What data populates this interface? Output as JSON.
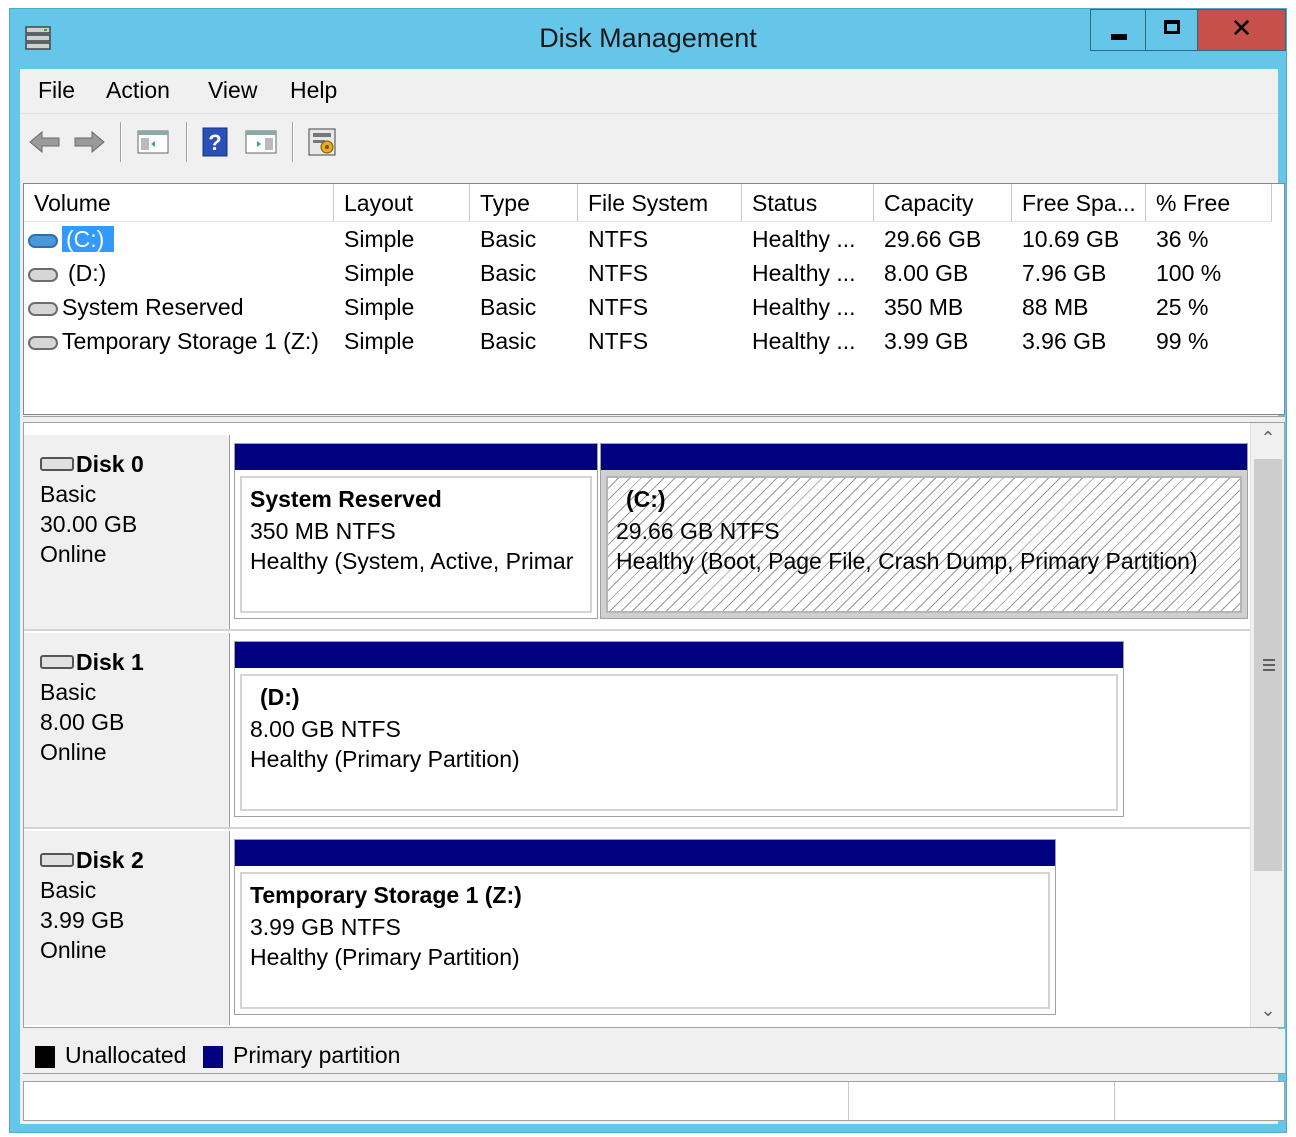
{
  "window": {
    "title": "Disk Management"
  },
  "menu": [
    "File",
    "Action",
    "View",
    "Help"
  ],
  "toolbar": {
    "buttons": [
      "back-arrow-icon",
      "forward-arrow-icon",
      "show-hide-console-tree-icon",
      "help-icon",
      "show-hide-action-pane-icon",
      "properties-icon"
    ]
  },
  "volume_list": {
    "columns": [
      "Volume",
      "Layout",
      "Type",
      "File System",
      "Status",
      "Capacity",
      "Free Spa...",
      "% Free"
    ],
    "rows": [
      {
        "volume": "(C:)",
        "layout": "Simple",
        "type": "Basic",
        "fs": "NTFS",
        "status": "Healthy ...",
        "capacity": "29.66 GB",
        "free": "10.69 GB",
        "pct": "36 %",
        "selected": true
      },
      {
        "volume": "(D:)",
        "layout": "Simple",
        "type": "Basic",
        "fs": "NTFS",
        "status": "Healthy ...",
        "capacity": "8.00 GB",
        "free": "7.96 GB",
        "pct": "100 %",
        "selected": false
      },
      {
        "volume": "System Reserved",
        "layout": "Simple",
        "type": "Basic",
        "fs": "NTFS",
        "status": "Healthy ...",
        "capacity": "350 MB",
        "free": "88 MB",
        "pct": "25 %",
        "selected": false
      },
      {
        "volume": "Temporary Storage 1 (Z:)",
        "layout": "Simple",
        "type": "Basic",
        "fs": "NTFS",
        "status": "Healthy ...",
        "capacity": "3.99 GB",
        "free": "3.96 GB",
        "pct": "99 %",
        "selected": false
      }
    ]
  },
  "disks": [
    {
      "name": "Disk 0",
      "kind": "Basic",
      "size": "30.00 GB",
      "state": "Online",
      "partitions": [
        {
          "name": "System Reserved",
          "size_fs": "350 MB NTFS",
          "health": "Healthy (System, Active, Primar",
          "hatched": false
        },
        {
          "name": "(C:)",
          "size_fs": "29.66 GB NTFS",
          "health": "Healthy (Boot, Page File, Crash Dump, Primary Partition)",
          "hatched": true
        }
      ]
    },
    {
      "name": "Disk 1",
      "kind": "Basic",
      "size": "8.00 GB",
      "state": "Online",
      "partitions": [
        {
          "name": "(D:)",
          "size_fs": "8.00 GB NTFS",
          "health": "Healthy (Primary Partition)",
          "hatched": false
        }
      ]
    },
    {
      "name": "Disk 2",
      "kind": "Basic",
      "size": "3.99 GB",
      "state": "Online",
      "partitions": [
        {
          "name": "Temporary Storage 1  (Z:)",
          "size_fs": "3.99 GB NTFS",
          "health": "Healthy (Primary Partition)",
          "hatched": false
        }
      ]
    }
  ],
  "legend": [
    {
      "label": "Unallocated",
      "color": "#000000"
    },
    {
      "label": "Primary partition",
      "color": "#000080"
    }
  ],
  "colors": {
    "titlebar": "#66c6ea",
    "close_button": "#c7514a",
    "primary_partition": "#000080",
    "selection": "#3399ff"
  }
}
